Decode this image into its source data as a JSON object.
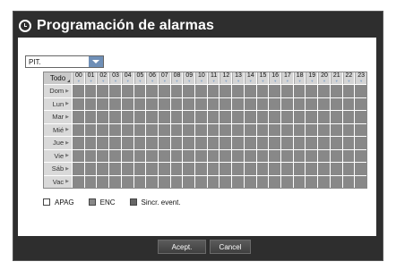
{
  "window": {
    "title": "Programación de alarmas",
    "icon": "clock-icon"
  },
  "channel_select": {
    "value": "PIT."
  },
  "grid": {
    "all_label": "Todo",
    "hours": [
      "00",
      "01",
      "02",
      "03",
      "04",
      "05",
      "06",
      "07",
      "08",
      "09",
      "10",
      "11",
      "12",
      "13",
      "14",
      "15",
      "16",
      "17",
      "18",
      "19",
      "20",
      "21",
      "22",
      "23"
    ],
    "days": [
      "Dom",
      "Lun",
      "Mar",
      "Mié",
      "Jue",
      "Vie",
      "Sáb",
      "Vac"
    ],
    "cell_state": "ENC"
  },
  "legend": [
    {
      "label": "APAG",
      "color": "#ffffff"
    },
    {
      "label": "ENC",
      "color": "#888888"
    },
    {
      "label": "Sincr. event.",
      "color": "#666666"
    }
  ],
  "buttons": {
    "ok": "Acept.",
    "cancel": "Cancel"
  }
}
